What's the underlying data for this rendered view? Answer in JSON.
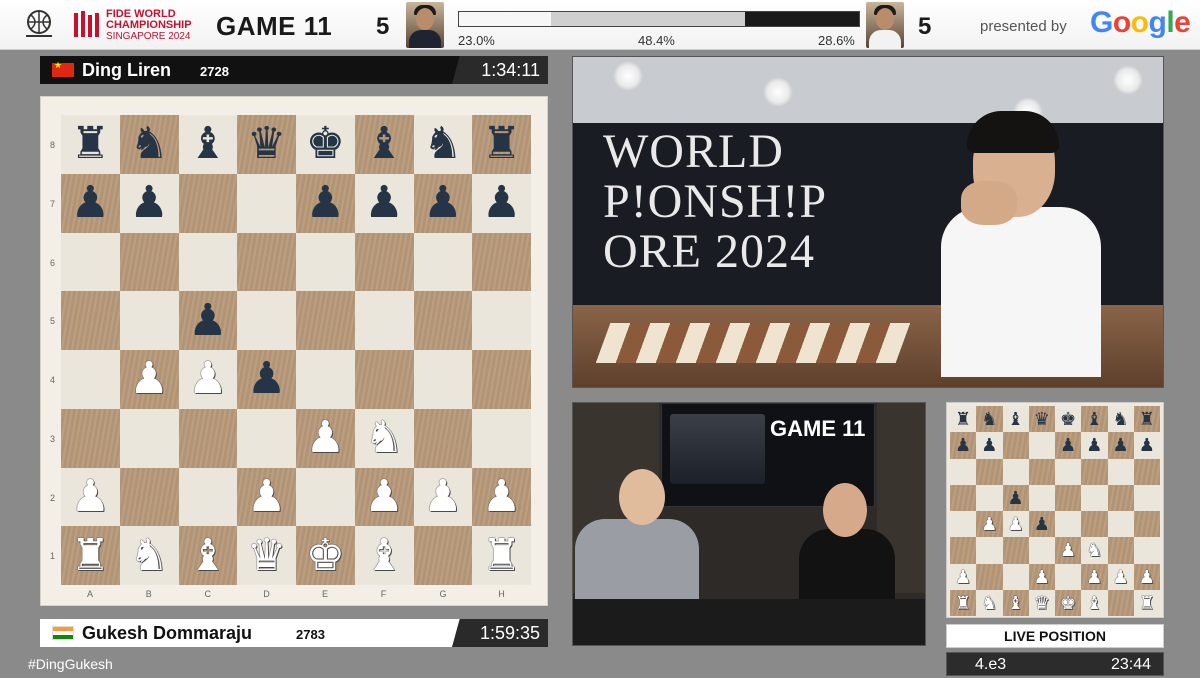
{
  "header": {
    "event_line1": "FIDE WORLD",
    "event_line2": "CHAMPIONSHIP",
    "event_line3": "SINGAPORE 2024",
    "game_label": "GAME 11",
    "score_white_player": "5",
    "score_black_player": "5",
    "eval": {
      "white_pct": "23.0%",
      "draw_pct": "48.4%",
      "black_pct": "28.6%",
      "white": 23.0,
      "draw": 48.4,
      "black": 28.6
    },
    "presented_by": "presented by",
    "sponsor": "Google"
  },
  "top_player": {
    "name": "Ding Liren",
    "rating": "2728",
    "clock": "1:34:11",
    "flag": "china-flag-icon"
  },
  "bottom_player": {
    "name": "Gukesh Dommaraju",
    "rating": "2783",
    "clock": "1:59:35",
    "flag": "india-flag-icon"
  },
  "board": {
    "ranks": [
      "8",
      "7",
      "6",
      "5",
      "4",
      "3",
      "2",
      "1"
    ],
    "files": [
      "A",
      "B",
      "C",
      "D",
      "E",
      "F",
      "G",
      "H"
    ],
    "position": [
      [
        "br",
        "bn",
        "bb",
        "bq",
        "bk",
        "bb",
        "bn",
        "br"
      ],
      [
        "bp",
        "bp",
        "",
        "",
        "bp",
        "bp",
        "bp",
        "bp"
      ],
      [
        "",
        "",
        "",
        "",
        "",
        "",
        "",
        ""
      ],
      [
        "",
        "",
        "bp",
        "",
        "",
        "",
        "",
        ""
      ],
      [
        "",
        "wp",
        "wp",
        "bp",
        "",
        "",
        "",
        ""
      ],
      [
        "",
        "",
        "",
        "",
        "wp",
        "wn",
        "",
        ""
      ],
      [
        "wp",
        "",
        "",
        "wp",
        "",
        "wp",
        "wp",
        "wp"
      ],
      [
        "wr",
        "wn",
        "wb",
        "wq",
        "wk",
        "wb",
        "",
        "wr"
      ]
    ]
  },
  "camera": {
    "wall_text": "WORLD\nP!ONSH!P\nORE 2024"
  },
  "studio": {
    "screen_title": "GAME 11"
  },
  "live": {
    "label": "LIVE POSITION",
    "move": "4.e3",
    "time": "23:44"
  },
  "hashtag": "#DingGukesh"
}
